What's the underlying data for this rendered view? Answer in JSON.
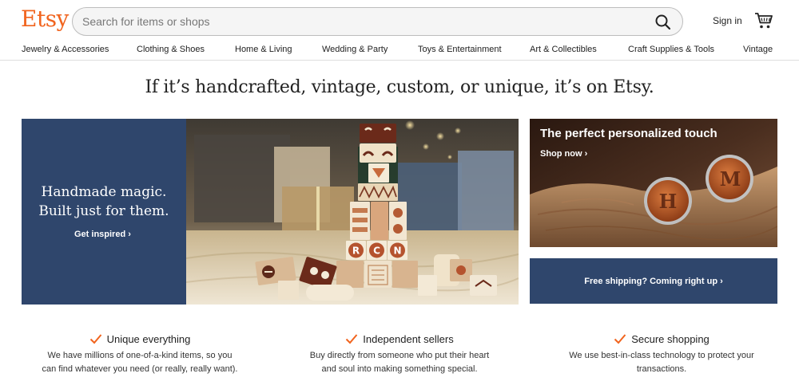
{
  "header": {
    "logo": "Etsy",
    "search_placeholder": "Search for items or shops",
    "sign_in": "Sign in"
  },
  "categories": [
    "Jewelry & Accessories",
    "Clothing & Shoes",
    "Home & Living",
    "Wedding & Party",
    "Toys & Entertainment",
    "Art & Collectibles",
    "Craft Supplies & Tools",
    "Vintage"
  ],
  "tagline": "If it’s handcrafted, vintage, custom, or unique, it’s on Etsy.",
  "hero": {
    "title_line1": "Handmade magic.",
    "title_line2": "Built just for them.",
    "link": "Get inspired",
    "block_letters": [
      "R",
      "C",
      "N"
    ]
  },
  "promo_top": {
    "title": "The perfect personalized touch",
    "link": "Shop now",
    "cufflink_letters": [
      "H",
      "M"
    ]
  },
  "promo_bottom": {
    "text": "Free shipping? Coming right up"
  },
  "value_props": [
    {
      "title": "Unique everything",
      "line1": "We have millions of one-of-a-kind items, so you",
      "line2": "can find whatever you need (or really, really want)."
    },
    {
      "title": "Independent sellers",
      "line1": "Buy directly from someone who put their heart",
      "line2": "and soul into making something special."
    },
    {
      "title": "Secure shopping",
      "line1": "We use best-in-class technology to protect your",
      "line2": "transactions."
    }
  ],
  "colors": {
    "brand_orange": "#F1641E",
    "navy": "#2F466C"
  }
}
